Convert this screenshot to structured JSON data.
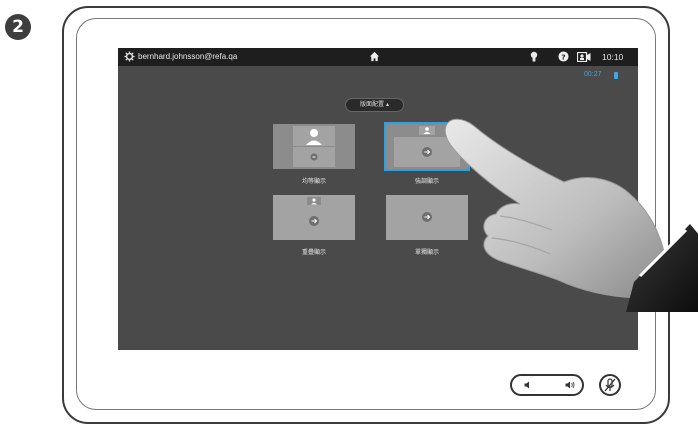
{
  "step": "2",
  "status_bar": {
    "user": "bernhard.johnsson@refa.qa",
    "time": "10:10"
  },
  "call_timer": "00:27",
  "layout_menu": {
    "label": "版面配置 ▴"
  },
  "layouts": [
    {
      "label": "均等顯示",
      "selected": false
    },
    {
      "label": "強調顯示",
      "selected": true
    },
    {
      "label": "重疊顯示",
      "selected": false
    },
    {
      "label": "單獨顯示",
      "selected": false
    }
  ],
  "colors": {
    "accent": "#2ba3e3",
    "screen_bg": "#4a4a4a",
    "topbar_bg": "#1e1e1e"
  },
  "icons": [
    "gear-icon",
    "home-icon",
    "lightbulb-icon",
    "help-icon",
    "camera-icon",
    "volume-down-icon",
    "volume-up-icon",
    "mic-mute-icon",
    "pointing-hand"
  ]
}
